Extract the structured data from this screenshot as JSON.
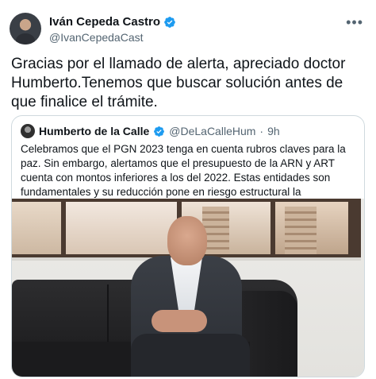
{
  "tweet": {
    "author_name": "Iván Cepeda Castro",
    "author_handle": "@IvanCepedaCast",
    "more_icon": "more-horizontal-icon",
    "text": "Gracias por el llamado de alerta, apreciado doctor Humberto.Tenemos que buscar solución antes de que finalice el trámite."
  },
  "quoted": {
    "author_name": "Humberto de la Calle",
    "author_handle": "@DeLaCalleHum",
    "separator": "·",
    "time": "9h",
    "text": "Celebramos que el PGN 2023 tenga en cuenta rubros claves para la paz. Sin embargo, alertamos que el presupuesto de la ARN y ART cuenta con montos inferiores a los del 2022. Estas entidades son fundamentales y su reducción pone en riesgo estructural la implementación del acuerdo."
  },
  "colors": {
    "verified": "#1d9bf0",
    "text_secondary": "#536471",
    "border": "#cfd9de"
  },
  "icons": {
    "verified": "verified-badge-icon"
  }
}
